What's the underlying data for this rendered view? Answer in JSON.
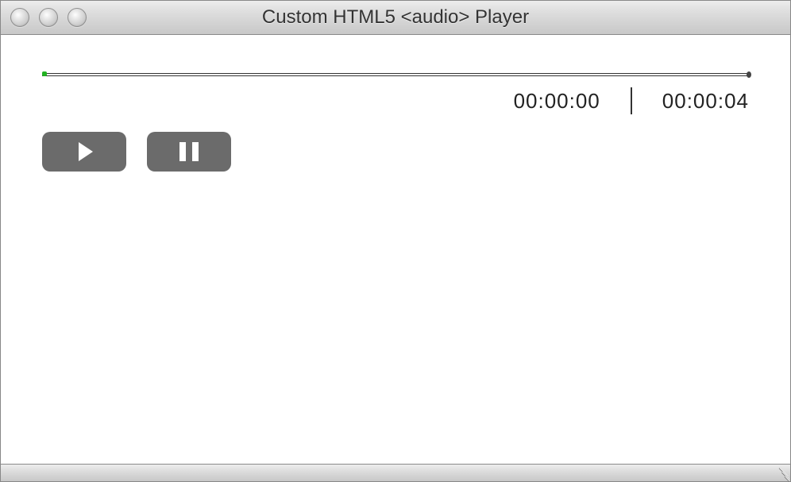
{
  "window": {
    "title": "Custom HTML5 <audio> Player"
  },
  "player": {
    "current_time": "00:00:00",
    "total_time": "00:00:04",
    "progress_percent": 0
  },
  "controls": {
    "play_label": "Play",
    "pause_label": "Pause"
  },
  "icons": {
    "close": "close-icon",
    "minimize": "minimize-icon",
    "zoom": "zoom-icon",
    "play": "play-icon",
    "pause": "pause-icon",
    "resize": "resize-grip-icon"
  }
}
